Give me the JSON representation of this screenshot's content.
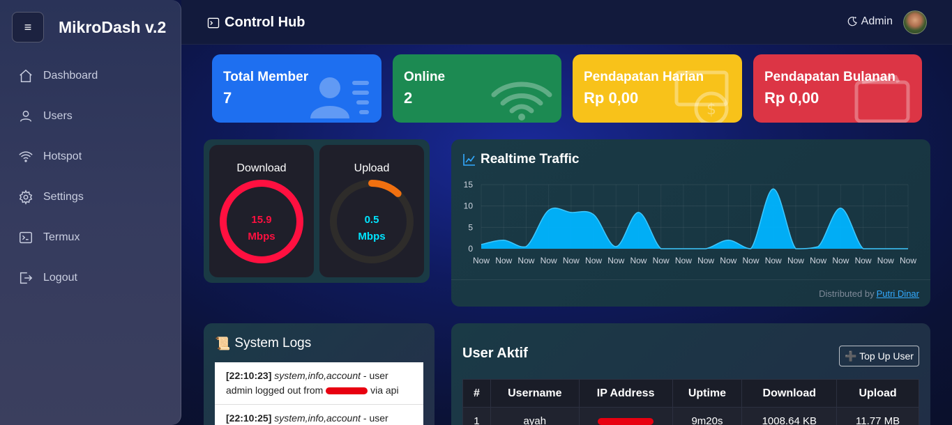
{
  "sidebar": {
    "brand": "MikroDash v.2",
    "menu_icon": "≡",
    "items": [
      {
        "label": "Dashboard",
        "icon": "home-icon"
      },
      {
        "label": "Users",
        "icon": "user-icon"
      },
      {
        "label": "Hotspot",
        "icon": "wifi-icon"
      },
      {
        "label": "Settings",
        "icon": "gear-icon"
      },
      {
        "label": "Termux",
        "icon": "terminal-icon"
      },
      {
        "label": "Logout",
        "icon": "logout-icon"
      }
    ]
  },
  "header": {
    "title": "Control Hub",
    "user": "Admin"
  },
  "stats": [
    {
      "label": "Total Member",
      "value": "7",
      "color": "#1e6ff0",
      "icon": "users-list-icon"
    },
    {
      "label": "Online",
      "value": "2",
      "color": "#1c8a52",
      "icon": "wifi-icon"
    },
    {
      "label": "Pendapatan Harian",
      "value": "Rp 0,00",
      "color": "#f8c21a",
      "icon": "money-icon"
    },
    {
      "label": "Pendapatan Bulanan",
      "value": "Rp 0,00",
      "color": "#dc3545",
      "icon": "wallet-icon"
    }
  ],
  "speed": {
    "download": {
      "title": "Download",
      "value": "15.9",
      "unit": "Mbps",
      "fraction": 1.0,
      "color": "#ff1040"
    },
    "upload": {
      "title": "Upload",
      "value": "0.5",
      "unit": "Mbps",
      "fraction": 0.12,
      "color": "#f07010"
    }
  },
  "traffic": {
    "title": "Realtime Traffic",
    "footer_prefix": "Distributed by",
    "footer_link": "Putri Dinar"
  },
  "chart_data": {
    "type": "area",
    "title": "Realtime Traffic",
    "x": [
      "Now",
      "Now",
      "Now",
      "Now",
      "Now",
      "Now",
      "Now",
      "Now",
      "Now",
      "Now",
      "Now",
      "Now",
      "Now",
      "Now",
      "Now",
      "Now",
      "Now",
      "Now",
      "Now",
      "Now"
    ],
    "series": [
      {
        "values": [
          1,
          2,
          0.5,
          9,
          8.5,
          8,
          0.5,
          8.5,
          0,
          0,
          0,
          2,
          0,
          14,
          0,
          0.5,
          9.5,
          0,
          0,
          0
        ]
      }
    ],
    "ylim": [
      0,
      15
    ],
    "yticks": [
      0,
      5,
      10,
      15
    ],
    "grid": true,
    "color": "#00b4ff"
  },
  "logs": {
    "title": "System Logs",
    "entries": [
      {
        "time": "[22:10:23]",
        "tag": "system,info,account",
        "text_pre": "- user admin logged out from",
        "text_post": "via api"
      },
      {
        "time": "[22:10:25]",
        "tag": "system,info,account",
        "text_pre": "- user",
        "text_post": ""
      }
    ]
  },
  "users": {
    "title": "User Aktif",
    "topup_label": "➕ Top Up User",
    "columns": [
      "#",
      "Username",
      "IP Address",
      "Uptime",
      "Download",
      "Upload"
    ],
    "rows": [
      {
        "no": "1",
        "username": "ayah",
        "uptime": "9m20s",
        "download": "1008.64 KB",
        "upload": "11.77 MB"
      }
    ]
  }
}
